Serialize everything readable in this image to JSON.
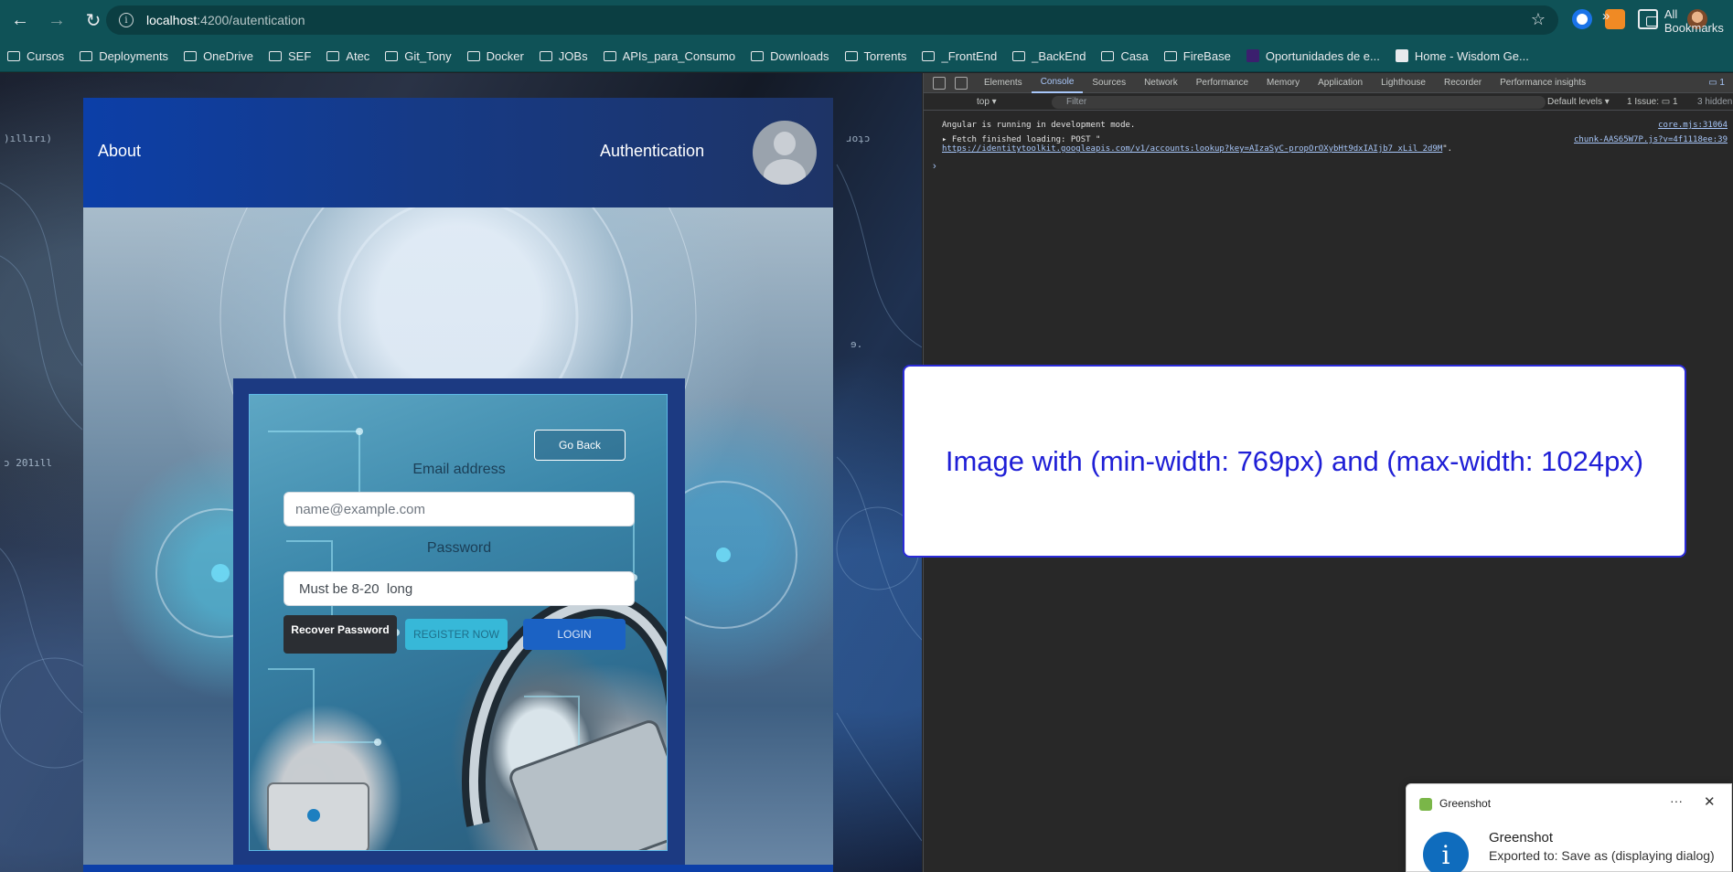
{
  "browser": {
    "url_host": "localhost",
    "url_path": ":4200/autentication",
    "bookmarks": [
      {
        "label": "Cursos",
        "type": "folder"
      },
      {
        "label": "Deployments",
        "type": "folder"
      },
      {
        "label": "OneDrive",
        "type": "folder"
      },
      {
        "label": "SEF",
        "type": "folder"
      },
      {
        "label": "Atec",
        "type": "folder"
      },
      {
        "label": "Git_Tony",
        "type": "folder"
      },
      {
        "label": "Docker",
        "type": "folder"
      },
      {
        "label": "JOBs",
        "type": "folder"
      },
      {
        "label": "APIs_para_Consumo",
        "type": "folder"
      },
      {
        "label": "Downloads",
        "type": "folder"
      },
      {
        "label": "Torrents",
        "type": "folder"
      },
      {
        "label": "_FrontEnd",
        "type": "folder"
      },
      {
        "label": "_BackEnd",
        "type": "folder"
      },
      {
        "label": "Casa",
        "type": "folder"
      },
      {
        "label": "FireBase",
        "type": "folder"
      },
      {
        "label": "Oportunidades de e...",
        "type": "site"
      },
      {
        "label": "Home - Wisdom Ge...",
        "type": "site"
      }
    ],
    "all_bookmarks": "All Bookmarks",
    "more": "»"
  },
  "app": {
    "nav_about": "About",
    "nav_auth": "Authentication",
    "form": {
      "go_back": "Go Back",
      "email_label": "Email address",
      "email_placeholder": "name@example.com",
      "password_label": "Password",
      "password_placeholder": "Must be 8-20  long",
      "recover": "Recover Password",
      "register": "REGISTER NOW",
      "login": "LOGIN"
    }
  },
  "media_query": {
    "text": "Image with (min-width: 769px) and (max-width: 1024px)"
  },
  "devtools": {
    "tabs": [
      "Elements",
      "Console",
      "Sources",
      "Network",
      "Performance",
      "Memory",
      "Application",
      "Lighthouse",
      "Recorder",
      "Performance insights"
    ],
    "active_tab": "Console",
    "context": "top ▾",
    "filter": "Filter",
    "levels": "Default levels ▾",
    "issues": "1 Issue: ▭ 1",
    "hidden": "3 hidden",
    "badge": "▭ 1",
    "console": {
      "line1": "Angular is running in development mode.",
      "line1_src": "core.mjs:31064",
      "line2": "▸ Fetch finished loading: POST \"",
      "line2_src": "chunk-AAS65W7P.js?v=4f1118ee:39",
      "line3_link": "https://identitytoolkit.googleapis.com/v1/accounts:lookup?key=AIzaSyC-propOrOXybHt9dxIAIjb7_xLil_2d9M",
      "line3_tail": "\"."
    }
  },
  "toast": {
    "app": "Greenshot",
    "title": "Greenshot",
    "message": "Exported to: Save as (displaying dialog)",
    "dots": "···",
    "close": "✕"
  },
  "colors": {
    "chrome": "#0f5257",
    "app_header": "#0c3fa8",
    "media_query_text": "#1f1fd6",
    "login_button": "#1b62c4",
    "register_button": "#37b8d8"
  }
}
